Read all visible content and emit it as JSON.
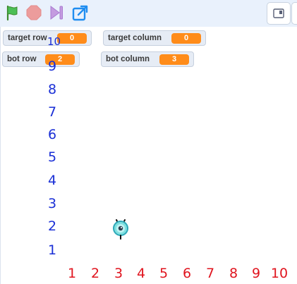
{
  "controls": {
    "green_flag_icon": "green-flag-icon",
    "stop_icon": "stop-icon",
    "turbo_icon": "turbo-icon",
    "share_icon": "share-icon"
  },
  "monitors": {
    "target_row": {
      "label": "target row",
      "value": "0"
    },
    "target_column": {
      "label": "target column",
      "value": "0"
    },
    "bot_row": {
      "label": "bot row",
      "value": "2"
    },
    "bot_column": {
      "label": "bot column",
      "value": "3"
    }
  },
  "stage": {
    "y_labels": [
      "10",
      "9",
      "8",
      "7",
      "6",
      "5",
      "4",
      "3",
      "2",
      "1"
    ],
    "x_labels": [
      "1",
      "2",
      "3",
      "4",
      "5",
      "6",
      "7",
      "8",
      "9",
      "10"
    ],
    "y_color": "#1a2fd6",
    "x_color": "#e0141e"
  },
  "colors": {
    "accent": "#ff8c1a",
    "toolbar_bg": "#e9f1fc"
  }
}
